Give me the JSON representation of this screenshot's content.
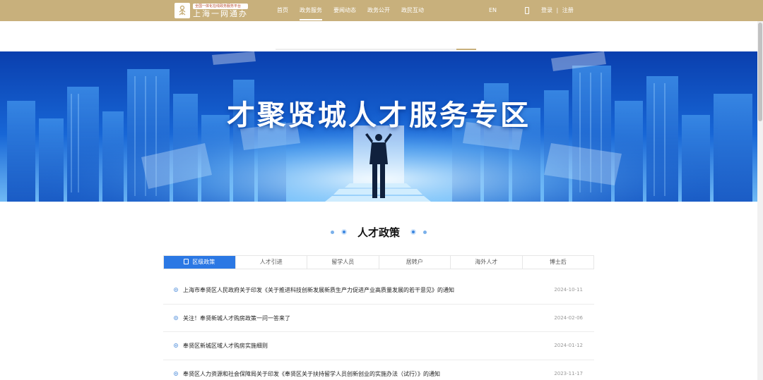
{
  "header": {
    "logo_subtitle": "全国一体化在线政务服务平台",
    "logo_title": "上海一网通办",
    "nav": [
      "首页",
      "政务服务",
      "要闻动态",
      "政务公开",
      "政民互动"
    ],
    "active_nav_index": 1,
    "lang": "EN",
    "login": "登录",
    "separator": "|",
    "register": "注册"
  },
  "banner": {
    "title": "才聚贤城人才服务专区"
  },
  "section": {
    "title": "人才政策"
  },
  "tabs": [
    "区级政策",
    "人才引进",
    "留学人员",
    "居转户",
    "海外人才",
    "博士后"
  ],
  "active_tab_index": 0,
  "list": [
    {
      "title": "上海市奉贤区人民政府关于印发《关于推进科技创新发展新质生产力促进产业高质量发展的若干意见》的通知",
      "date": "2024-10-11"
    },
    {
      "title": "关注！奉贤新城人才购房政策一问一答来了",
      "date": "2024-02-06"
    },
    {
      "title": "奉贤区新城区域人才购房实施细则",
      "date": "2024-01-12"
    },
    {
      "title": "奉贤区人力资源和社会保障局关于印发《奉贤区关于扶持留学人员创新创业的实施办法（试行）》的通知",
      "date": "2023-11-17"
    }
  ],
  "colors": {
    "header_bg": "#c8b07c",
    "accent_blue": "#2b78e4",
    "banner_deep": "#0a3fae"
  }
}
